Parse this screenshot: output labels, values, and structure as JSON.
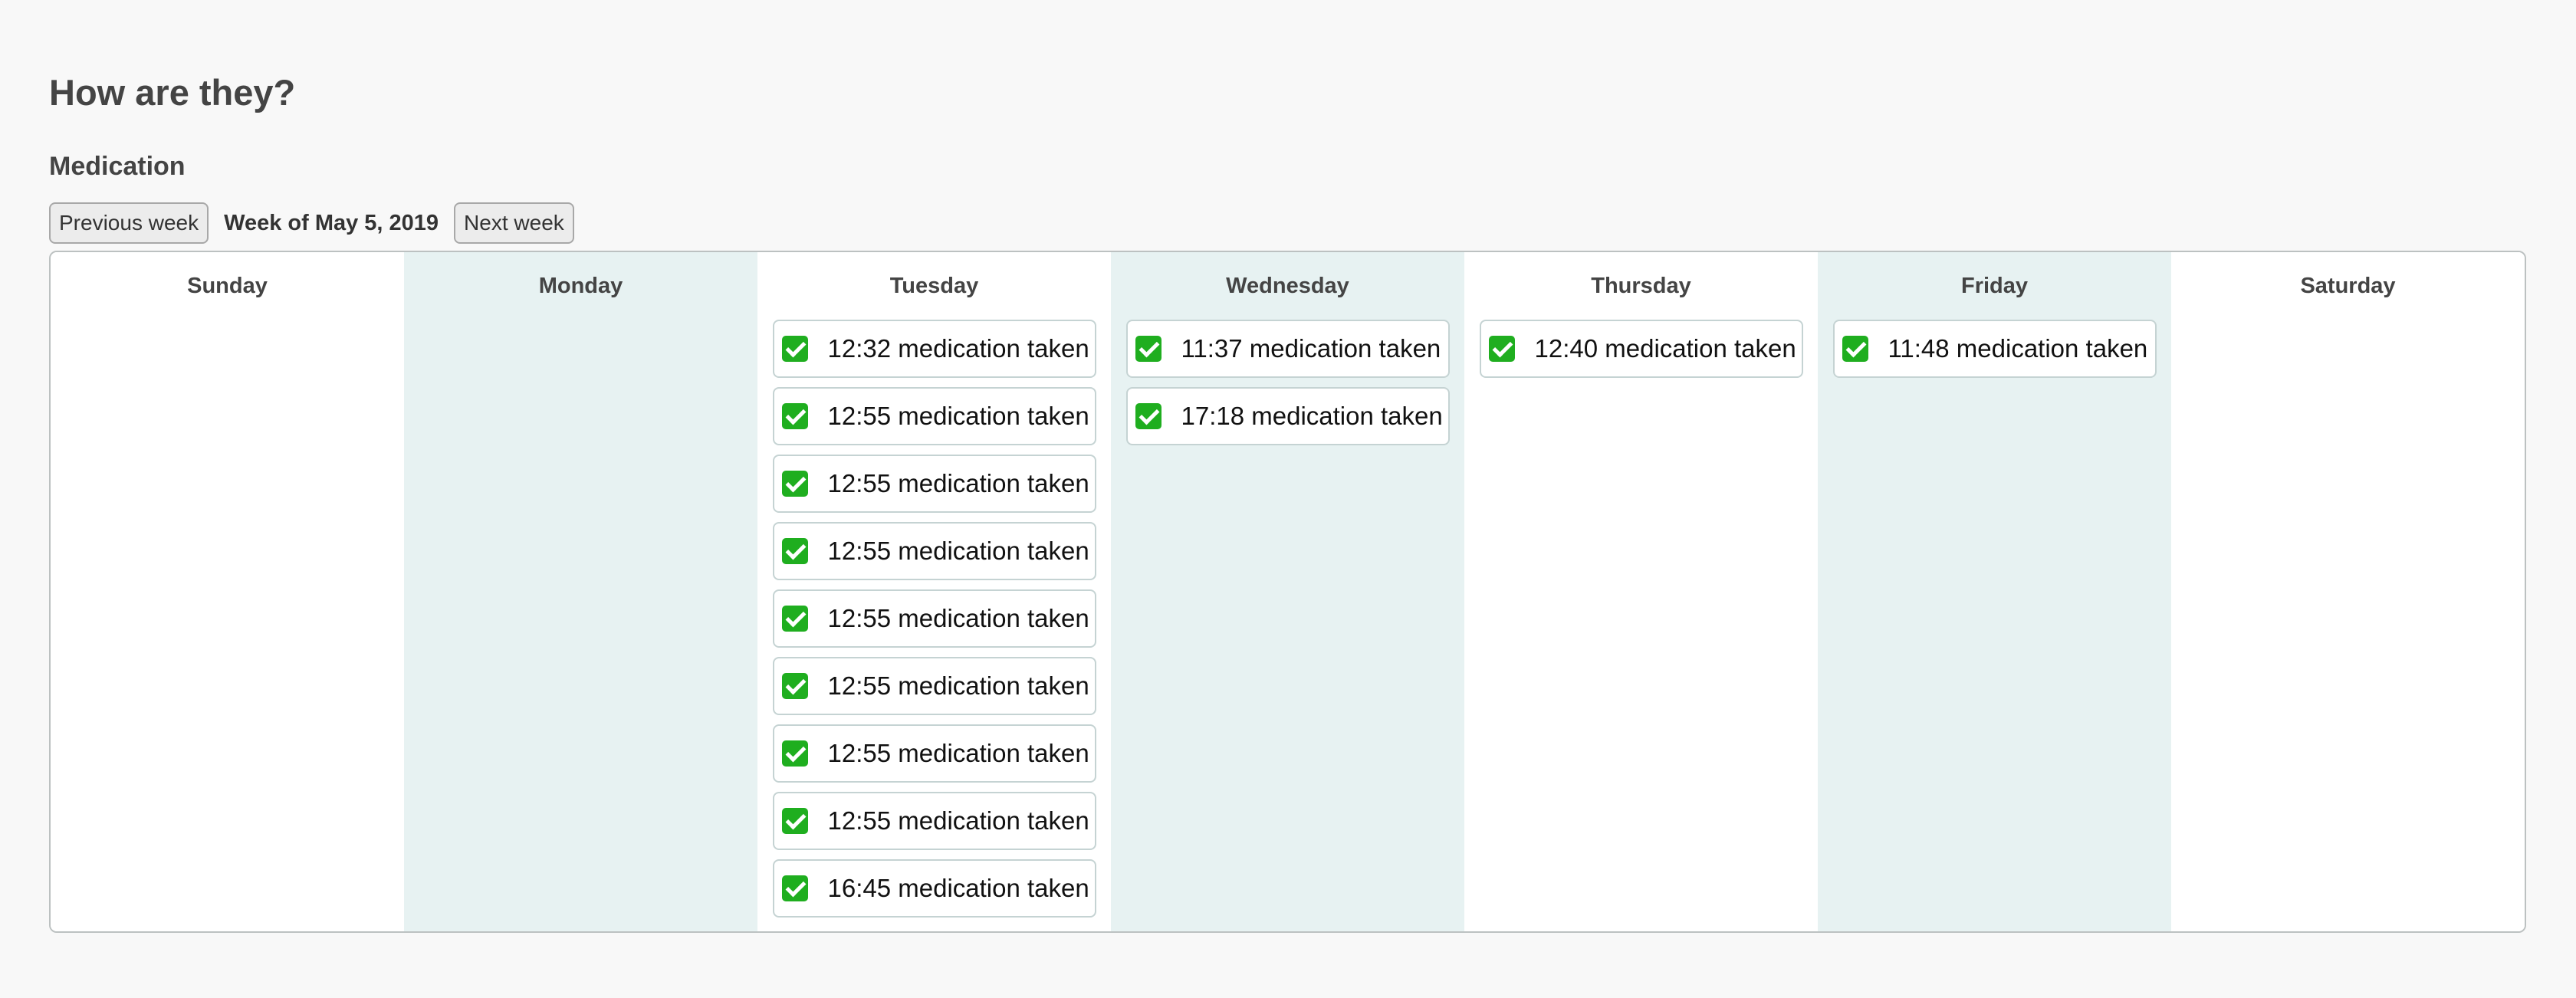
{
  "page": {
    "title": "How are they?"
  },
  "section": {
    "title": "Medication"
  },
  "week_nav": {
    "previous_label": "Previous week",
    "week_label": "Week of May 5, 2019",
    "next_label": "Next week"
  },
  "calendar": {
    "days": [
      {
        "name": "Sunday",
        "entries": []
      },
      {
        "name": "Monday",
        "entries": []
      },
      {
        "name": "Tuesday",
        "entries": [
          {
            "icon": "check-icon",
            "text": "12:32 medication taken"
          },
          {
            "icon": "check-icon",
            "text": "12:55 medication taken"
          },
          {
            "icon": "check-icon",
            "text": "12:55 medication taken"
          },
          {
            "icon": "check-icon",
            "text": "12:55 medication taken"
          },
          {
            "icon": "check-icon",
            "text": "12:55 medication taken"
          },
          {
            "icon": "check-icon",
            "text": "12:55 medication taken"
          },
          {
            "icon": "check-icon",
            "text": "12:55 medication taken"
          },
          {
            "icon": "check-icon",
            "text": "12:55 medication taken"
          },
          {
            "icon": "check-icon",
            "text": "16:45 medication taken"
          }
        ]
      },
      {
        "name": "Wednesday",
        "entries": [
          {
            "icon": "check-icon",
            "text": "11:37 medication taken"
          },
          {
            "icon": "check-icon",
            "text": "17:18 medication taken"
          }
        ]
      },
      {
        "name": "Thursday",
        "entries": [
          {
            "icon": "check-icon",
            "text": "12:40 medication taken"
          }
        ]
      },
      {
        "name": "Friday",
        "entries": [
          {
            "icon": "check-icon",
            "text": "11:48 medication taken"
          }
        ]
      },
      {
        "name": "Saturday",
        "entries": []
      }
    ]
  },
  "colors": {
    "page_background": "#f8f8f8",
    "shaded_column": "#e7f2f2",
    "check_green": "#1fae1f"
  }
}
